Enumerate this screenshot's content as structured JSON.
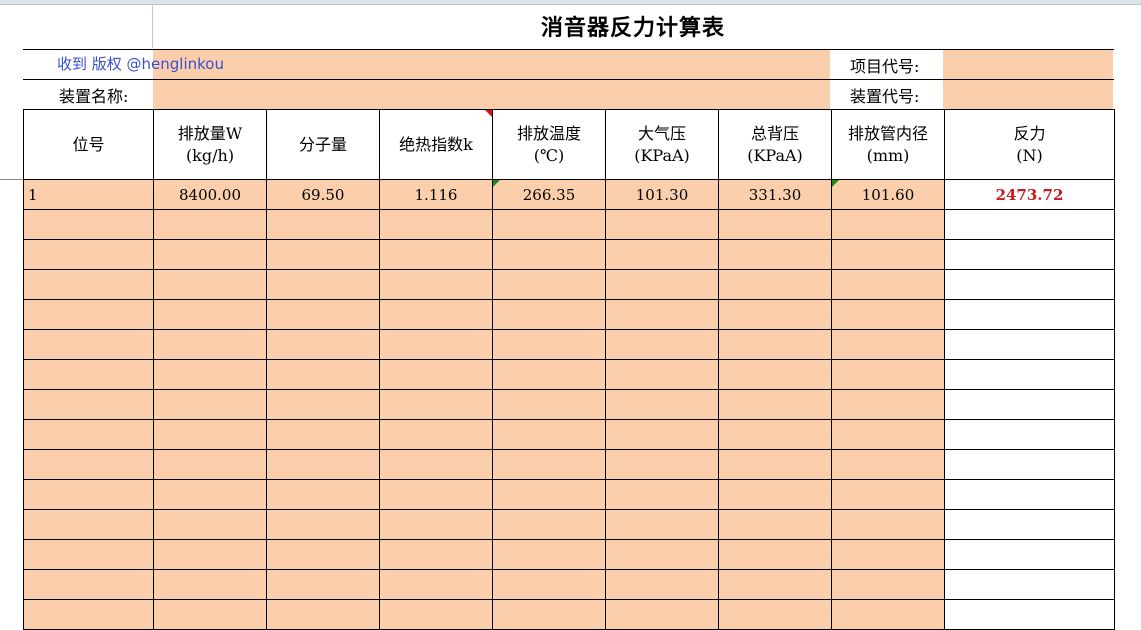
{
  "title": "消音器反力计算表",
  "watermark": "收到 版权 @henglinkou",
  "info": {
    "project_code_label": "项目代号:",
    "device_name_label": "装置名称:",
    "device_code_label": "装置代号:"
  },
  "headers": [
    {
      "l1": "位号",
      "l2": ""
    },
    {
      "l1": "排放量W",
      "l2": "(kg/h)"
    },
    {
      "l1": "分子量",
      "l2": ""
    },
    {
      "l1": "绝热指数k",
      "l2": ""
    },
    {
      "l1": "排放温度",
      "l2": "(℃)"
    },
    {
      "l1": "大气压",
      "l2": "(KPaA)"
    },
    {
      "l1": "总背压",
      "l2": "(KPaA)"
    },
    {
      "l1": "排放管内径",
      "l2": "(mm)"
    },
    {
      "l1": "反力",
      "l2": "(N)"
    }
  ],
  "rows": [
    [
      "1",
      "8400.00",
      "69.50",
      "1.116",
      "266.35",
      "101.30",
      "331.30",
      "101.60",
      "2473.72"
    ]
  ]
}
